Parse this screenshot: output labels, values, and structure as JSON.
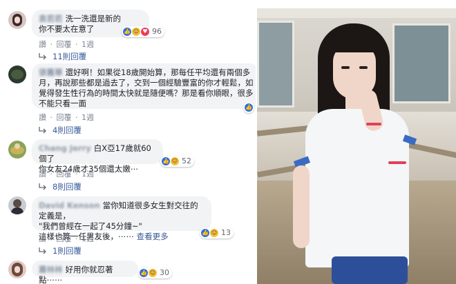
{
  "action_labels": {
    "like": "讚",
    "reply": "回覆",
    "sep": "·"
  },
  "comments": [
    {
      "name": "袁若若",
      "lines": [
        "洗一洗還是新的",
        "你不要太在意了"
      ],
      "reaction_count": "96",
      "time": "1週",
      "replies": "11則回覆"
    },
    {
      "name": "張舊華",
      "lines": [
        "還好啊！如果從18歲開始算，那每任平均還有兩個多",
        "月，再說那些都是過去了，交到一個經驗豐富的你才輕鬆，如",
        "覺得發生性行為的時間太快就是隨便嗎？那是看你順眼，很多",
        "不能只看一面"
      ],
      "reaction_count": "",
      "time": "1週",
      "replies": "4則回覆"
    },
    {
      "name": "Chang Jerry",
      "lines": [
        "白X亞17歲就60個了",
        "你女友24歲才35個還太嫩⋯"
      ],
      "reaction_count": "52",
      "time": "1週",
      "replies": "8則回覆"
    },
    {
      "name": "David Kenson",
      "lines": [
        "當你知道很多女生對交往的定義是，",
        "\"我們曾經在一起了45分鐘~\"",
        "這樣也算一任男友後，⋯⋯"
      ],
      "read_more": "查看更多",
      "reaction_count": "13",
      "time": "1週",
      "replies": "1則回覆"
    },
    {
      "name": "蕭林林",
      "lines": [
        "好用你就忍著點⋯⋯"
      ],
      "reaction_count": "30"
    }
  ],
  "colors": {
    "link": "#385898",
    "bubble": "#f2f3f5",
    "like": "#2f6fe0",
    "love": "#ef3b58",
    "haha": "#f2c040"
  }
}
